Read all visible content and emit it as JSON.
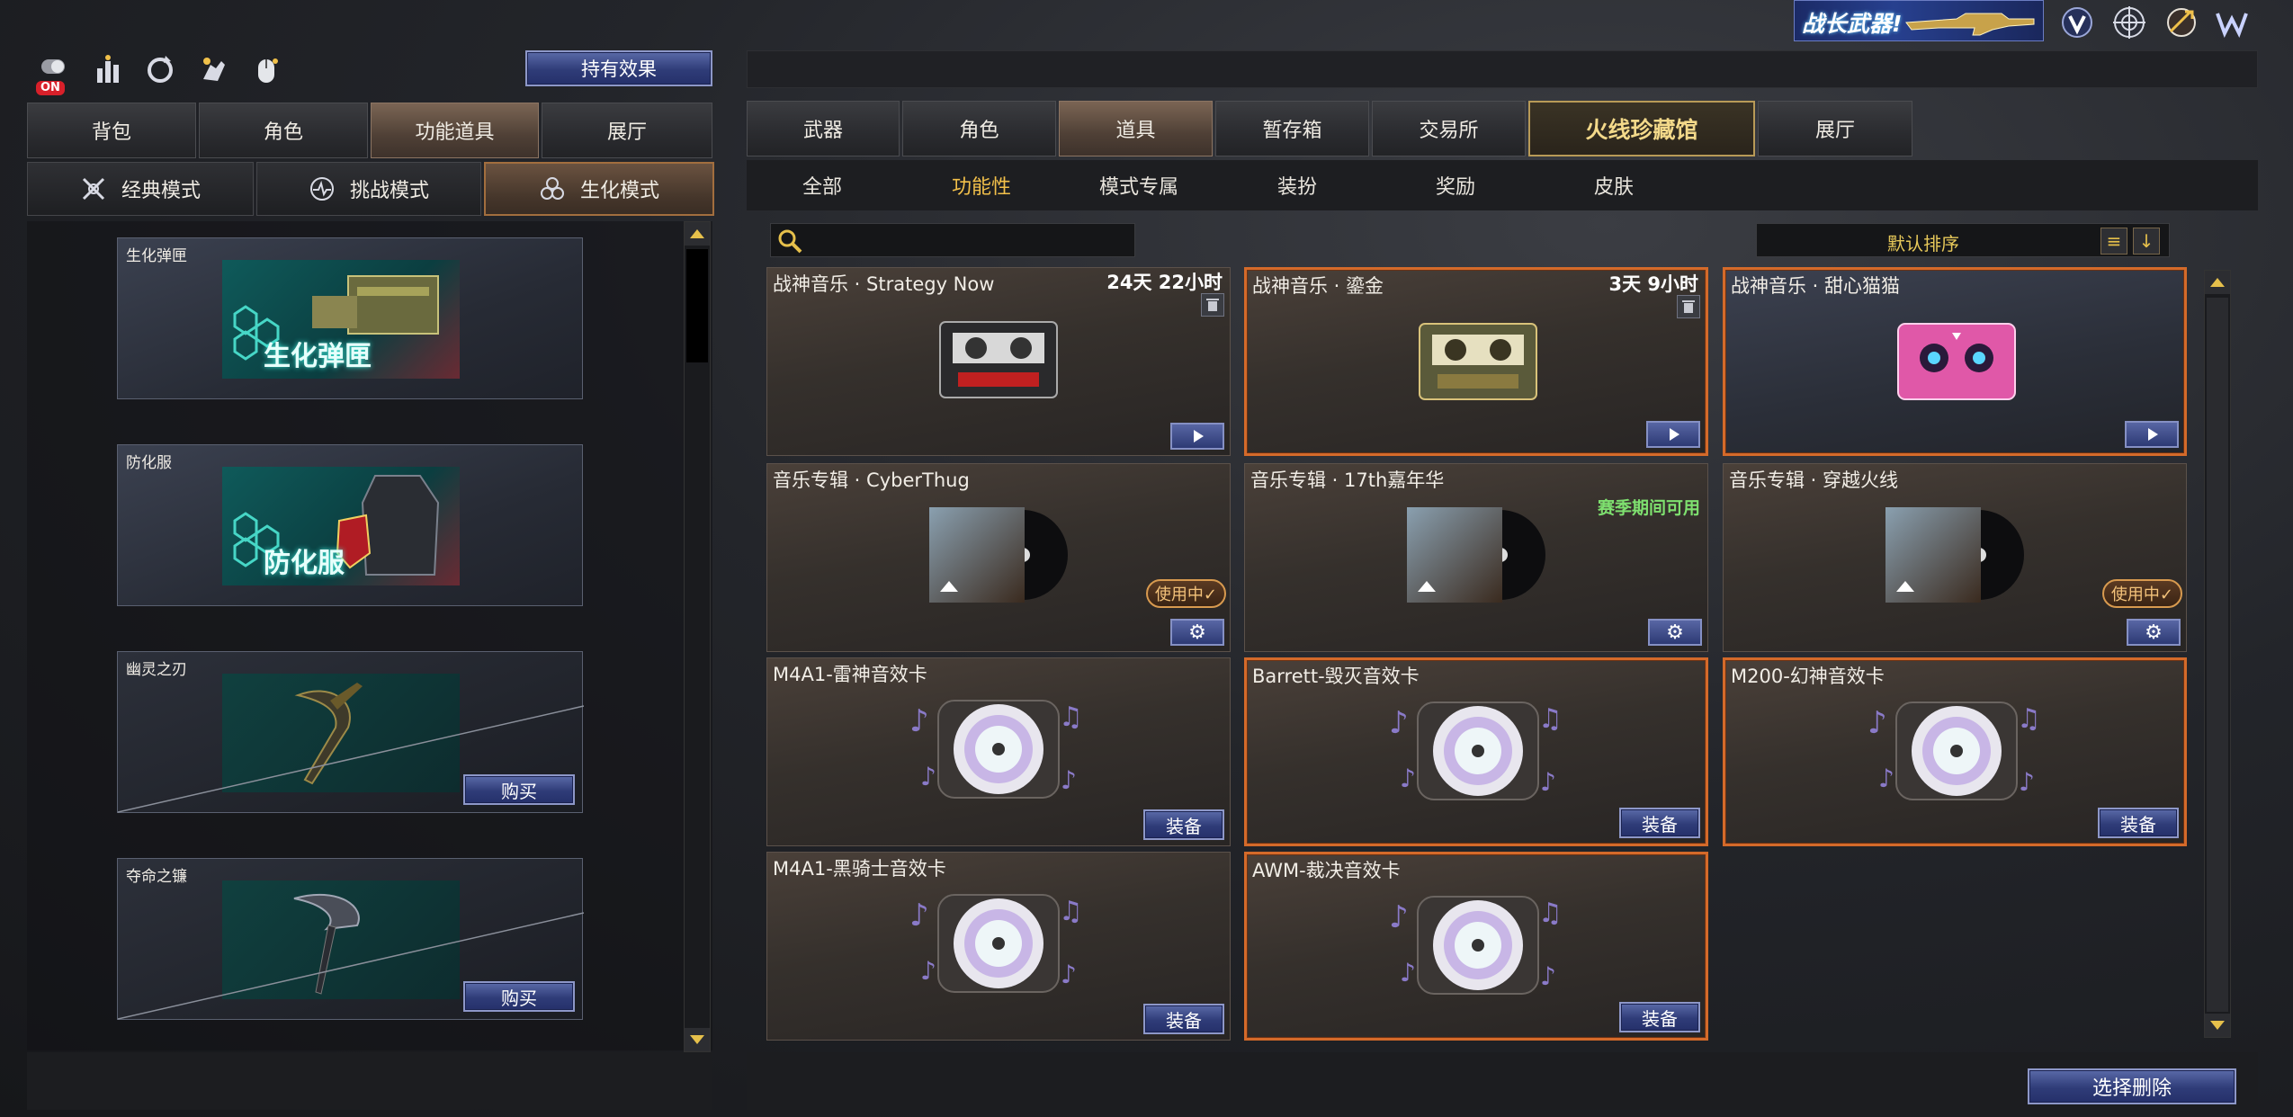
{
  "top_right": {
    "banner_text": "战长武器!",
    "icons": [
      "v-rank-icon",
      "target-icon",
      "crosshair-badge-icon",
      "w-logo-icon"
    ]
  },
  "top_left": {
    "icons": [
      "toggle-on-icon",
      "stats-icon",
      "refresh-icon",
      "hand-icon",
      "mouse-icon"
    ],
    "on_badge": "ON",
    "hold_effect_button": "持有效果"
  },
  "left_tabs": [
    {
      "label": "背包",
      "active": false
    },
    {
      "label": "角色",
      "active": false
    },
    {
      "label": "功能道具",
      "active": true
    },
    {
      "label": "展厅",
      "active": false
    }
  ],
  "modes": [
    {
      "label": "经典模式",
      "icon": "classic-mode-icon",
      "active": false
    },
    {
      "label": "挑战模式",
      "icon": "challenge-mode-icon",
      "active": false
    },
    {
      "label": "生化模式",
      "icon": "biohazard-mode-icon",
      "active": true
    }
  ],
  "left_items": [
    {
      "title": "生化弹匣",
      "art_text": "生化弹匣",
      "buy": ""
    },
    {
      "title": "防化服",
      "art_text": "防化服",
      "buy": ""
    },
    {
      "title": "幽灵之刃",
      "art_text": "",
      "buy": "购买"
    },
    {
      "title": "夺命之镰",
      "art_text": "",
      "buy": "购买"
    }
  ],
  "right_tabs": [
    {
      "label": "武器"
    },
    {
      "label": "角色"
    },
    {
      "label": "道具",
      "active": true
    },
    {
      "label": "暂存箱"
    },
    {
      "label": "交易所"
    },
    {
      "label": "火线珍藏馆",
      "featured": true
    },
    {
      "label": "展厅"
    }
  ],
  "sub_tabs": [
    {
      "label": "全部"
    },
    {
      "label": "功能性",
      "active": true
    },
    {
      "label": "模式专属"
    },
    {
      "label": "装扮"
    },
    {
      "label": "奖励"
    },
    {
      "label": "皮肤"
    }
  ],
  "search": {
    "placeholder": ""
  },
  "sort": {
    "label": "默认排序"
  },
  "cards": [
    {
      "name": "战神音乐 · Strategy Now",
      "time": "24天 22小时",
      "kind": "cassette-dark",
      "action": "play",
      "trash": true
    },
    {
      "name": "战神音乐 · 鎏金",
      "time": "3天 9小时",
      "kind": "cassette-gold",
      "action": "play",
      "trash": true,
      "selected": true
    },
    {
      "name": "战神音乐 · 甜心猫猫",
      "kind": "cassette-pink",
      "action": "play",
      "selected": true,
      "cool": true
    },
    {
      "name": "音乐专辑 · CyberThug",
      "kind": "album",
      "action": "gear",
      "in_use": "使用中✓"
    },
    {
      "name": "音乐专辑 · 17th嘉年华",
      "kind": "album",
      "action": "gear",
      "season": "赛季期间可用"
    },
    {
      "name": "音乐专辑 · 穿越火线",
      "kind": "album",
      "action": "gear",
      "in_use": "使用中✓"
    },
    {
      "name": "M4A1-雷神音效卡",
      "kind": "disc",
      "action": "equip",
      "equip": "装备"
    },
    {
      "name": "Barrett-毁灭音效卡",
      "kind": "disc",
      "action": "equip",
      "equip": "装备",
      "selected": true
    },
    {
      "name": "M200-幻神音效卡",
      "kind": "disc",
      "action": "equip",
      "equip": "装备",
      "selected": true
    },
    {
      "name": "M4A1-黑骑士音效卡",
      "kind": "disc",
      "action": "equip",
      "equip": "装备"
    },
    {
      "name": "AWM-裁决音效卡",
      "kind": "disc",
      "action": "equip",
      "equip": "装备",
      "selected": true
    }
  ],
  "bottom": {
    "delete_button": "选择删除"
  }
}
